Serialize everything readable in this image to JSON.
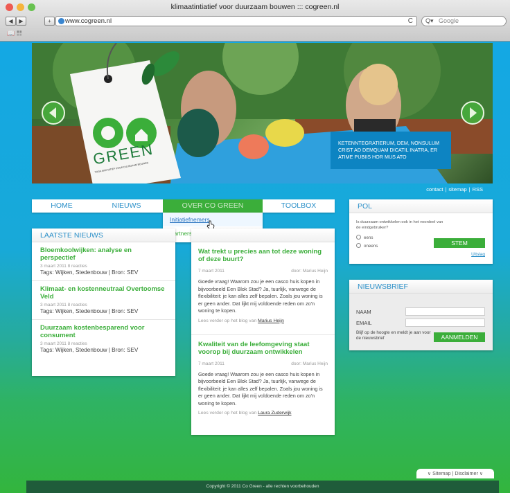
{
  "browser": {
    "title": "klimaatintiatief voor duurzaam bouwen ::: cogreen.nl",
    "url": "www.cogreen.nl",
    "search_placeholder": "Google",
    "back": "◀",
    "forward": "▶",
    "plus": "+",
    "reload": "C",
    "search_prefix": "Q▾",
    "bookmarks": "📖 ☷"
  },
  "hero": {
    "caption": "Ketenntegratierum, dem, nonsulum crist ad demquam dicatil inatra, er atime pubiis hor mus ato",
    "logo_line1": "CO",
    "logo_line2": "GREEN",
    "logo_tagline": "TOGA AINITIATIEF VOOR DUURZAAM BOUWEN"
  },
  "utility": [
    "contact",
    "sitemap",
    "RSS"
  ],
  "nav": {
    "items": [
      "HOME",
      "NIEUWS",
      "OVER CO GREEN",
      "TOOLBOX"
    ],
    "dropdown": [
      "Initiatiefnemers",
      "Partners"
    ]
  },
  "news": {
    "heading": "LAATSTE NIEUWS",
    "items": [
      {
        "title": "Bloemkoolwijken: analyse en perspectief",
        "meta": "3 maart 2011     8 reacties",
        "tags": "Tags: Wijken, Stedenbouw | Bron: SEV"
      },
      {
        "title": "Klimaat- en kostenneutraal Overtoomse Veld",
        "meta": "3 maart 2011     8 reacties",
        "tags": "Tags: Wijken, Stedenbouw | Bron: SEV"
      },
      {
        "title": "Duurzaam kostenbesparend voor consument",
        "meta": "3 maart 2011     8 reacties",
        "tags": "Tags: Wijken, Stedenbouw | Bron: SEV"
      }
    ]
  },
  "articles": [
    {
      "title": "Wat trekt u precies aan tot deze woning of deze buurt?",
      "date": "7 maart 2011",
      "author": "door: Marius Heijn",
      "body": "Goede vraag! Waarom zou je een casco huis kopen in bijvoorbeeld Een Blok Stad? Ja, tuurlijk, vanwege de flexibiliteit: je kan alles zelf bepalen. Zoals jou woning is er geen ander. Dat lijkt mij voldoende reden om zo'n woning te kopen.",
      "more_prefix": "Lees verder op het blog van",
      "more_link": "Marius Heijn"
    },
    {
      "title": "Kwaliteit van de leefomgeving staat voorop bij duurzaam ontwikkelen",
      "date": "7 maart 2011",
      "author": "door: Marius Heijn",
      "body": "Goede vraag! Waarom zou je een casco huis kopen in bijvoorbeeld Een Blok Stad? Ja, tuurlijk, vanwege de flexibiliteit: je kan alles zelf bepalen. Zoals jou woning is er geen ander. Dat lijkt mij voldoende reden om zo'n woning te kopen.",
      "more_prefix": "Lees verder op het blog van",
      "more_link": "Laura Zuderwijk"
    }
  ],
  "poll": {
    "heading": "POL",
    "question": "Is duurzaam ontwikkelen ook in het voordeel van de eindgebruiker?",
    "options": [
      "eens",
      "oneens"
    ],
    "button": "STEM",
    "result_link": "Uitslag"
  },
  "newsletter": {
    "heading": "NIEUWSBRIEF",
    "name_label": "NAAM",
    "email_label": "EMAIL",
    "note": "Blijf op de hoogte en meldt je aan voor de nieuwsbrief",
    "button": "AANMELDEN"
  },
  "footer": {
    "copyright": "Copyright © 2011 Co Green - alle rechten voorbehouden",
    "sitemap": "Sitemap",
    "disclaimer": "Disclaimer"
  },
  "colors": {
    "brand_green": "#3bae3a",
    "link_blue": "#2a8fc8",
    "caption_blue": "#0d84c2",
    "footer": "#1f5c3a"
  }
}
